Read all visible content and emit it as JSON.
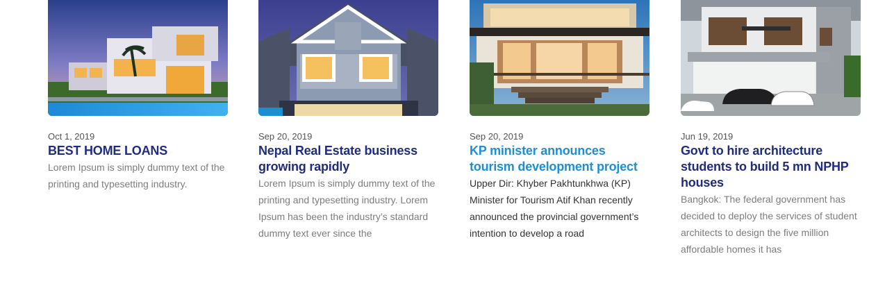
{
  "posts": [
    {
      "date": "Oct 1, 2019",
      "title": "BEST HOME LOANS",
      "excerpt": "Lorem Ipsum is simply dummy text of the printing and typesetting industry.",
      "image_icon": "modern-villa-dusk-photo"
    },
    {
      "date": "Sep 20, 2019",
      "title": "Nepal Real Estate business growing rapidly",
      "excerpt": "Lorem Ipsum is simply dummy text of the printing and typesetting industry. Lorem Ipsum has been the industry’s standard dummy text ever since the",
      "image_icon": "gabled-house-photo"
    },
    {
      "date": "Sep 20, 2019",
      "title": "KP minister announces tourism development project",
      "excerpt": "Upper Dir: Khyber Pakhtunkhwa (KP) Minister for Tourism Atif Khan recently announced the provincial government’s intention to develop a road",
      "image_icon": "two-storey-house-porch-photo"
    },
    {
      "date": "Jun 19, 2019",
      "title": "Govt to hire architecture students to build 5 mn NPHP houses",
      "excerpt": "Bangkok: The federal government has decided to deploy the services of student architects to design the five million affordable homes it has",
      "image_icon": "townhouse-garage-cars-photo"
    }
  ],
  "colors": {
    "title": "#1f2c80",
    "title_hover": "#1e8fd6",
    "excerpt": "#7d7d7d",
    "date": "#555555"
  }
}
